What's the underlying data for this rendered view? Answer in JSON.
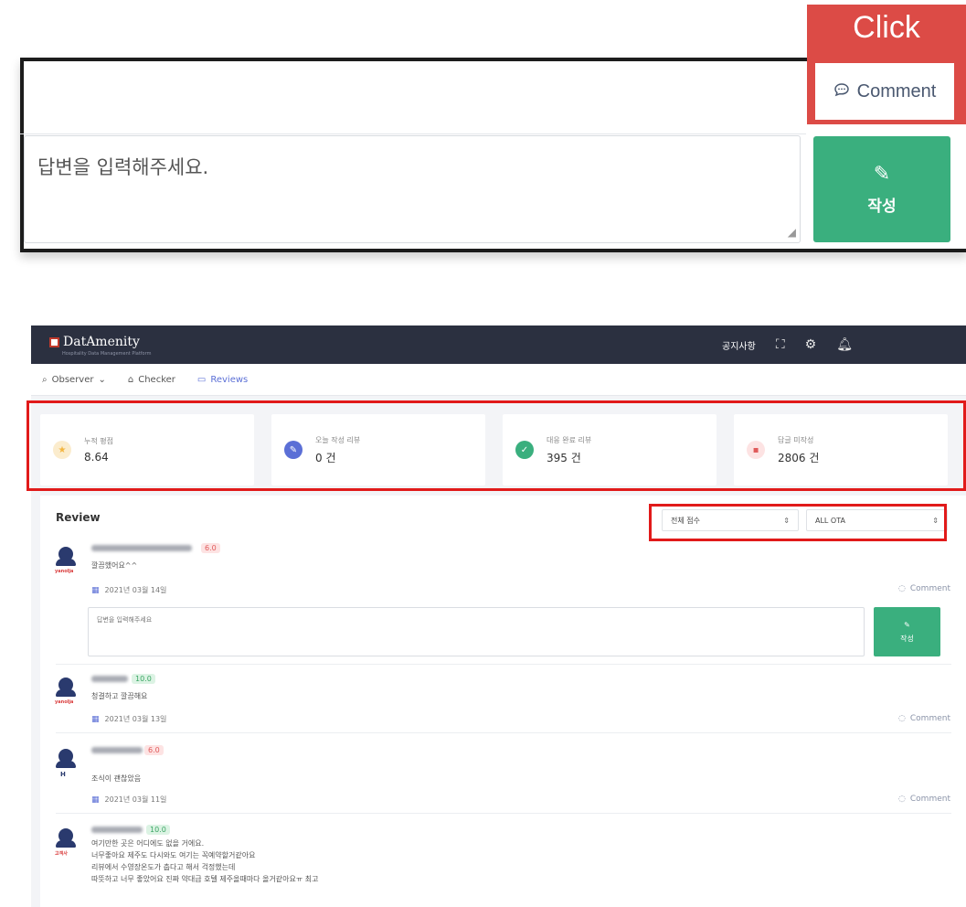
{
  "callout": {
    "click_label": "Click",
    "comment_label": "Comment",
    "textarea_placeholder": "답변을 입력해주세요.",
    "submit_label": "작성"
  },
  "app": {
    "logo": "DatAmenity",
    "logo_subtitle": "Hospitality Data Management Platform",
    "nav_notice": "공지사항",
    "subnav": [
      {
        "label": "Observer"
      },
      {
        "label": "Checker"
      },
      {
        "label": "Reviews"
      }
    ],
    "stats": [
      {
        "label": "누적 평점",
        "value": "8.64",
        "color": "#f3b53f"
      },
      {
        "label": "오늘 작성 리뷰",
        "value": "0 건",
        "color": "#5b6fd6"
      },
      {
        "label": "대응 완료 리뷰",
        "value": "395 건",
        "color": "#3aaf7e"
      },
      {
        "label": "답글 미작성",
        "value": "2806 건",
        "color": "#e05a5a"
      }
    ],
    "review_title": "Review",
    "filter_score": "전체 점수",
    "filter_ota": "ALL OTA",
    "reviews": [
      {
        "score": "6.0",
        "text": "깔끔했어요^^",
        "date": "2021년 03월 14일",
        "ota": "yanolja"
      },
      {
        "score": "10.0",
        "text": "청결하고 깔끔해요",
        "date": "2021년 03월 13일",
        "ota": "yanolja"
      },
      {
        "score": "6.0",
        "text": "조식이 괜찮았음",
        "date": "2021년 03월 11일",
        "ota": "H"
      },
      {
        "score": "10.0",
        "lines": [
          "여기만한 곳은 어디에도 없을 거에요.",
          "너무좋아요 제주도 다시와도 여기는 꼭예약할거같아요",
          "리뷰에서 수영장온도가 춥다고 해서 걱정했는데",
          "따뜻하고 너무 좋았어요 진짜 약대급 호텔 제주올때마다 올거같아요ㅠ 최고"
        ],
        "ota": "고객사"
      }
    ],
    "comment_label": "Comment",
    "textarea_placeholder": "답변을 입력해주세요",
    "submit_label": "작성"
  }
}
